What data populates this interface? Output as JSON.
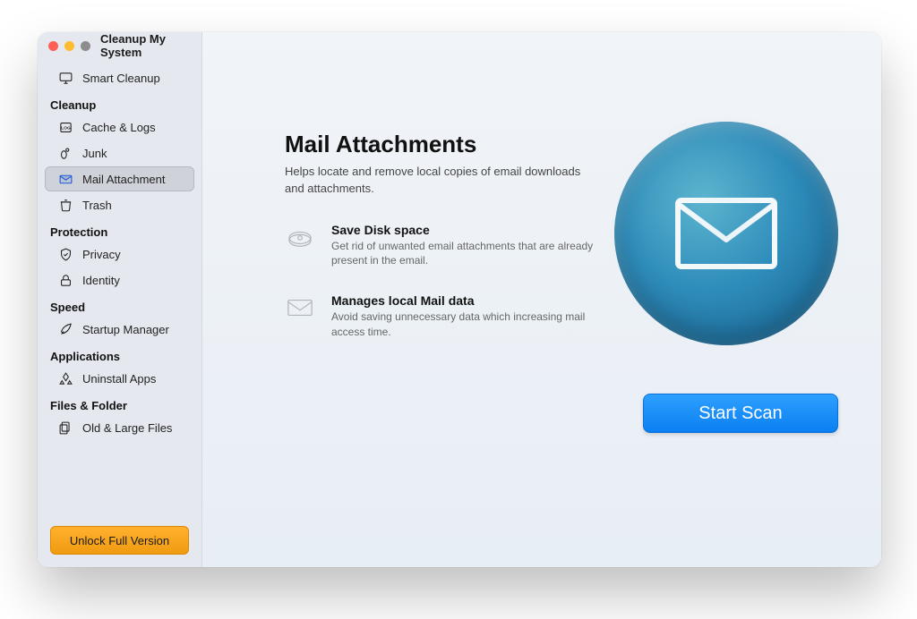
{
  "window": {
    "title": "Cleanup My System"
  },
  "sidebar": {
    "top": {
      "label": "Smart Cleanup"
    },
    "sections": {
      "cleanup": {
        "head": "Cleanup",
        "items": [
          {
            "label": "Cache & Logs"
          },
          {
            "label": "Junk"
          },
          {
            "label": "Mail Attachment"
          },
          {
            "label": "Trash"
          }
        ]
      },
      "protection": {
        "head": "Protection",
        "items": [
          {
            "label": "Privacy"
          },
          {
            "label": "Identity"
          }
        ]
      },
      "speed": {
        "head": "Speed",
        "items": [
          {
            "label": "Startup Manager"
          }
        ]
      },
      "applications": {
        "head": "Applications",
        "items": [
          {
            "label": "Uninstall Apps"
          }
        ]
      },
      "files": {
        "head": "Files & Folder",
        "items": [
          {
            "label": "Old & Large Files"
          }
        ]
      }
    },
    "unlock_label": "Unlock Full Version"
  },
  "main": {
    "title": "Mail Attachments",
    "subtitle": "Helps locate and remove local copies of email downloads and attachments.",
    "features": [
      {
        "title": "Save Disk space",
        "desc": "Get rid of unwanted email attachments that are already present in the email."
      },
      {
        "title": "Manages local Mail data",
        "desc": "Avoid saving unnecessary data which increasing mail access time."
      }
    ],
    "scan_label": "Start Scan"
  }
}
